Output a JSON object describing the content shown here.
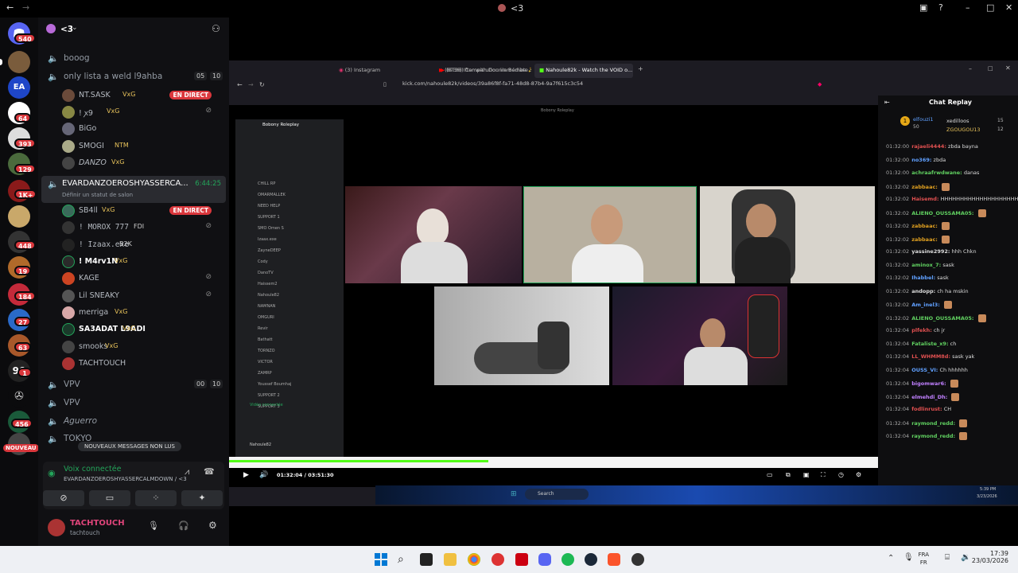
{
  "window": {
    "title": "<3"
  },
  "server": {
    "name": "<3"
  },
  "rail_badges": [
    "540",
    "64",
    "393",
    "129",
    "1K+",
    "448",
    "19",
    "184",
    "27",
    "63",
    "1",
    "456"
  ],
  "rail_new_label": "NOUVEAU",
  "channels": [
    {
      "name": "booog",
      "type": "voice"
    },
    {
      "name": "only lista a weld l9ahba",
      "type": "voice",
      "counts": [
        "05",
        "10"
      ]
    },
    {
      "name": "EVARDANZOEROSHYASSERCA...",
      "type": "voice",
      "active": true,
      "timer": "6:44:25",
      "status_hint": "Définir un statut de salon"
    },
    {
      "name": "VPV",
      "type": "voice",
      "counts": [
        "00",
        "10"
      ]
    },
    {
      "name": "VPV",
      "type": "voice"
    },
    {
      "name": "Aguerro",
      "type": "voice"
    },
    {
      "name": "TOKYO",
      "type": "voice"
    }
  ],
  "users_group1": [
    {
      "name": "NT.SASK",
      "tag": "VxG",
      "live": true
    },
    {
      "name": "! ꭗ9",
      "tag": "VxG"
    },
    {
      "name": "BiGo",
      "tag": ""
    },
    {
      "name": "SMOGI",
      "tag": "NTM"
    },
    {
      "name": "DANZO",
      "tag": "VxG"
    }
  ],
  "users_group2": [
    {
      "name": "SB4ll",
      "tag": "VxG",
      "live": true
    },
    {
      "name": "! MOROX 777",
      "tag": "FDI"
    },
    {
      "name": "! Izaax.exe",
      "tag": "B2K"
    },
    {
      "name": "! M4rv1N",
      "tag": "VxG"
    },
    {
      "name": "KAGE",
      "tag": ""
    },
    {
      "name": "Lil SNEAKY",
      "tag": ""
    },
    {
      "name": "merriga",
      "tag": "VxG"
    },
    {
      "name": "SA3ADAT L9ADI",
      "tag": "VxG"
    },
    {
      "name": "smooks",
      "tag": "VxG"
    },
    {
      "name": "TACHTOUCH",
      "tag": ""
    }
  ],
  "live_label": "EN DIRECT",
  "new_messages_pill": "NOUVEAUX MESSAGES NON LUS",
  "voice": {
    "status": "Voix connectée",
    "channel": "EVARDANZOEROSHYASSERCALMDOWN / <3"
  },
  "user": {
    "display": "TACHTOUCH",
    "username": "tachtouch"
  },
  "browser": {
    "tabs": [
      "(8736) Iftar with Dounia Bomba ✨ ...",
      "(3) Instagram",
      "(8736) Comparution immédiate : jug...",
      "Nahoule82k - Watch the VOID o..."
    ],
    "url": "kick.com/nahoule82k/videos/39a86f8f-fa71-48d8-87b4-9a7f615c3c54",
    "chat_title": "Chat Replay",
    "leaderboard": [
      {
        "name": "elfouzi1",
        "score": "50"
      },
      {
        "name": "xedilloos",
        "score": "15"
      },
      {
        "name": "ZGOUGOU13",
        "score": "12"
      }
    ],
    "time": "01:32:04 / 03:51:30"
  },
  "nested_discord": {
    "server": "Bobony Roleplay",
    "title": "Bobony Roleplay",
    "channels": [
      "CHILL RP",
      "OMARMALLEK",
      "NEED HELP",
      "SUPPORT 1",
      "SMO Omen S",
      "Izaax.exe",
      "ZayneDEEP",
      "Cody",
      "DanoTV",
      "Haissem2",
      "Nahoule82",
      "NAMNAN",
      "OMGURI",
      "Revir",
      "Bathatt",
      "TORNZO",
      "VICTOR",
      "ZAMRP",
      "Youssef Boumhaj",
      "SUPPORT 2",
      "SUPPORT 3"
    ],
    "video_connected": "Vidéo connectée",
    "user": "Nahoule82"
  },
  "chat_messages": [
    {
      "t": "01:32:00",
      "u": "rajaeli4444",
      "m": "zbda bayna",
      "c": "#e05050"
    },
    {
      "t": "01:32:00",
      "u": "no369",
      "m": "zbda",
      "c": "#60a0ff"
    },
    {
      "t": "01:32:00",
      "u": "achraafrwdwane",
      "m": "danas",
      "c": "#60d060"
    },
    {
      "t": "01:32:02",
      "u": "zabbaac",
      "m": "",
      "c": "#e0a020"
    },
    {
      "t": "01:32:02",
      "u": "Haisemd",
      "m": "HHHHHHHHHHHHHHHHHHHHHHHHHHHHH",
      "c": "#e05050"
    },
    {
      "t": "01:32:02",
      "u": "ALIENO_OUSSAMA05",
      "m": "",
      "c": "#60d060"
    },
    {
      "t": "01:32:02",
      "u": "zabbaac",
      "m": "",
      "c": "#e0a020"
    },
    {
      "t": "01:32:02",
      "u": "zabbaac",
      "m": "",
      "c": "#e0a020"
    },
    {
      "t": "01:32:02",
      "u": "yassine2992",
      "m": "hhh Chkn",
      "c": "#ddd"
    },
    {
      "t": "01:32:02",
      "u": "aminox_7",
      "m": "sask",
      "c": "#60d060"
    },
    {
      "t": "01:32:02",
      "u": "Ihabbel",
      "m": "sask",
      "c": "#60a0ff"
    },
    {
      "t": "01:32:02",
      "u": "andopp",
      "m": "ch ha mskin",
      "c": "#ddd"
    },
    {
      "t": "01:32:02",
      "u": "Am_inel3",
      "m": "",
      "c": "#60a0ff"
    },
    {
      "t": "01:32:02",
      "u": "ALIENO_OUSSAMA05",
      "m": "",
      "c": "#60d060"
    },
    {
      "t": "01:32:04",
      "u": "plfekh",
      "m": "ch jr",
      "c": "#e05050"
    },
    {
      "t": "01:32:04",
      "u": "Fataliste_x9",
      "m": "ch",
      "c": "#60d060"
    },
    {
      "t": "01:32:04",
      "u": "LL_WHMM8d",
      "m": "sask yak",
      "c": "#e05050"
    },
    {
      "t": "01:32:04",
      "u": "OUSS_VI",
      "m": "Ch hhhhhh",
      "c": "#60a0ff"
    },
    {
      "t": "01:32:04",
      "u": "bigomwar6",
      "m": "",
      "c": "#c080ff"
    },
    {
      "t": "01:32:04",
      "u": "elmehdi_Dh",
      "m": "",
      "c": "#c080ff"
    },
    {
      "t": "01:32:04",
      "u": "fodlinrust",
      "m": "CH",
      "c": "#e05050"
    },
    {
      "t": "01:32:04",
      "u": "raymond_redd",
      "m": "",
      "c": "#60d060"
    },
    {
      "t": "01:32:04",
      "u": "raymond_redd",
      "m": "",
      "c": "#60d060"
    }
  ],
  "taskbar": {
    "lang": [
      "FRA",
      "FR"
    ],
    "time": "17:39",
    "date": "23/03/2026"
  },
  "inner_taskbar": {
    "search": "Search",
    "time": "5:39 PM",
    "date": "3/23/2026"
  },
  "colors": {
    "accent_green": "#23a55a",
    "live_red": "#da373c",
    "kick_green": "#53fc18"
  }
}
